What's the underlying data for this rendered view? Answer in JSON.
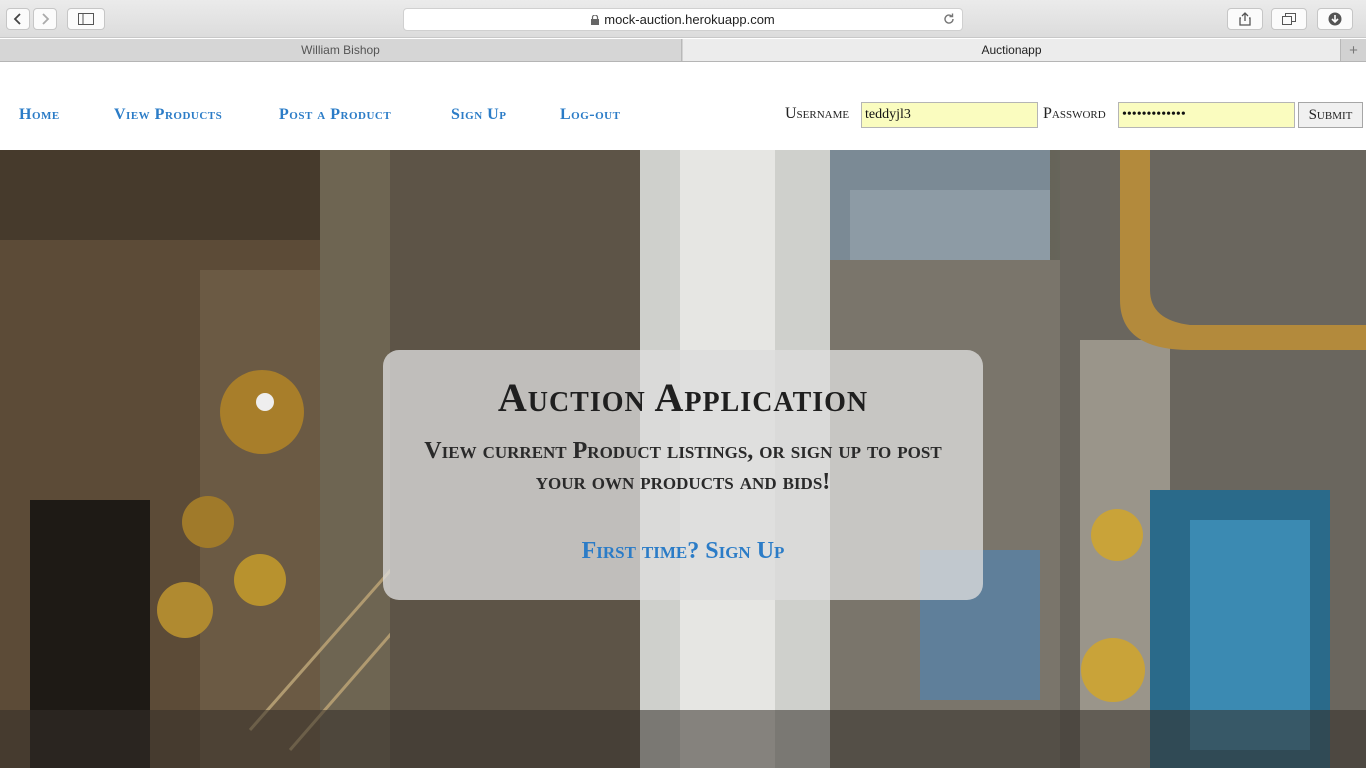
{
  "browser": {
    "url": "mock-auction.herokuapp.com",
    "tabs": [
      {
        "label": "William Bishop",
        "active": false
      },
      {
        "label": "Auctionapp",
        "active": true
      }
    ],
    "add_tab_label": "+",
    "icons": [
      "back-icon",
      "forward-icon",
      "sidebar-icon",
      "lock-icon",
      "reload-icon",
      "share-icon",
      "tabs-icon",
      "download-icon"
    ]
  },
  "nav": {
    "links": [
      "Home",
      "View Products",
      "Post a Product",
      "Sign Up",
      "Log-out"
    ],
    "link_color": "#2b7cc7"
  },
  "login": {
    "username_label": "Username",
    "username_value": "teddyjl3",
    "password_label": "Password",
    "password_value": "•••••••••••••",
    "submit_label": "Submit",
    "field_color": "#fafcbf"
  },
  "hero": {
    "title": "Auction Application",
    "subtitle": "View current Product listings, or sign up to post your own products and bids!",
    "cta": "First time? Sign Up"
  }
}
